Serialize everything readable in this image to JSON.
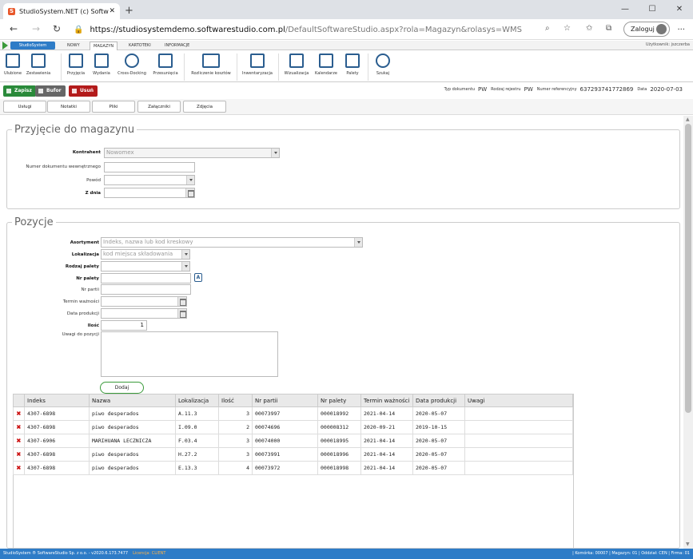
{
  "browser": {
    "tab_title": "StudioSystem.NET (c) SoftwareSt",
    "url_host": "https://studiosystemdemo.softwarestudio.com.pl",
    "url_path": "/DefaultSoftwareStudio.aspx?rola=Magazyn&rolasys=WMS",
    "login_label": "Zaloguj"
  },
  "app": {
    "brand": "StudioSystem",
    "tabs": [
      "NOWY",
      "MAGAZYN",
      "KARTOTEKI",
      "INFORMACJE"
    ],
    "active_tab": "MAGAZYN",
    "user": "Użytkownik: jszczerba"
  },
  "ribbon": {
    "groups": [
      [
        "Ulubione",
        "Zestawienia"
      ],
      [
        "Przyjęcia",
        "Wydania",
        "Cross-Docking",
        "Przesunięcia"
      ],
      [
        "Rozliczenie kosztów"
      ],
      [
        "Inwentaryzacja"
      ],
      [
        "Wizualizacja",
        "Kalendarze",
        "Palety"
      ],
      [
        "Szukaj"
      ]
    ]
  },
  "toolbar": {
    "save": "Zapisz",
    "buffer": "Bufor",
    "delete": "Usuń",
    "doc_type_label": "Typ dokumentu",
    "doc_type": "PW",
    "register_label": "Rodzaj rejestru",
    "register": "PW",
    "ref_label": "Numer referencyjny",
    "ref": "637293741772869",
    "date_label": "Data",
    "date": "2020-07-03"
  },
  "subtabs": [
    "Usługi",
    "Notatki",
    "Pliki",
    "Załączniki",
    "Zdjęcia"
  ],
  "section1": {
    "title": "Przyjęcie do magazynu",
    "kontrahent_label": "Kontrahent",
    "kontrahent_value": "Nowomex",
    "numer_label": "Numer dokumentu wewnętrznego",
    "numer_value": "",
    "powod_label": "Powód",
    "powod_value": "",
    "zdnia_label": "Z dnia",
    "zdnia_value": ""
  },
  "section2": {
    "title": "Pozycje",
    "asortyment_label": "Asortyment",
    "asortyment_placeholder": "Indeks, nazwa lub kod kreskowy",
    "lokalizacja_label": "Lokalizacja",
    "lokalizacja_placeholder": "kod miejsca składowania",
    "rodzaj_palety_label": "Rodzaj palety",
    "nr_palety_label": "Nr palety",
    "nr_partii_label": "Nr partii",
    "termin_label": "Termin ważności",
    "data_prod_label": "Data produkcji",
    "ilosc_label": "Ilość",
    "ilosc_value": "1",
    "uwagi_label": "Uwagi do pozycji",
    "add_button": "Dodaj"
  },
  "grid": {
    "columns": [
      "Indeks",
      "Nazwa",
      "Lokalizacja",
      "Ilość",
      "Nr partii",
      "Nr palety",
      "Termin ważności",
      "Data produkcji",
      "Uwagi"
    ],
    "rows": [
      [
        "4307-6898",
        "piwo desperados",
        "A.11.3",
        "3",
        "00073997",
        "000018992",
        "2021-04-14",
        "2020-05-07",
        ""
      ],
      [
        "4307-6898",
        "piwo desperados",
        "I.09.0",
        "2",
        "00074696",
        "000008312",
        "2020-09-21",
        "2019-10-15",
        ""
      ],
      [
        "4307-6906",
        "MARIHUANA LECZNICZA",
        "F.03.4",
        "3",
        "00074000",
        "000018995",
        "2021-04-14",
        "2020-05-07",
        ""
      ],
      [
        "4307-6898",
        "piwo desperados",
        "H.27.2",
        "3",
        "00073991",
        "000018996",
        "2021-04-14",
        "2020-05-07",
        ""
      ],
      [
        "4307-6898",
        "piwo desperados",
        "E.13.3",
        "4",
        "00073972",
        "000018998",
        "2021-04-14",
        "2020-05-07",
        ""
      ]
    ]
  },
  "status": {
    "left": "StudioSystem ® SoftwareStudio Sp. z o.o. - v2020.6.173.7477",
    "license": "Licencja: CLIENT",
    "right": "| Komórka: 00007 | Magazyn: 01 | Oddział: CEN | Firma: 01"
  },
  "colors": {
    "accent": "#2e7cc7",
    "save": "#2a8a3a",
    "buffer": "#666666",
    "delete": "#b31b1b"
  }
}
